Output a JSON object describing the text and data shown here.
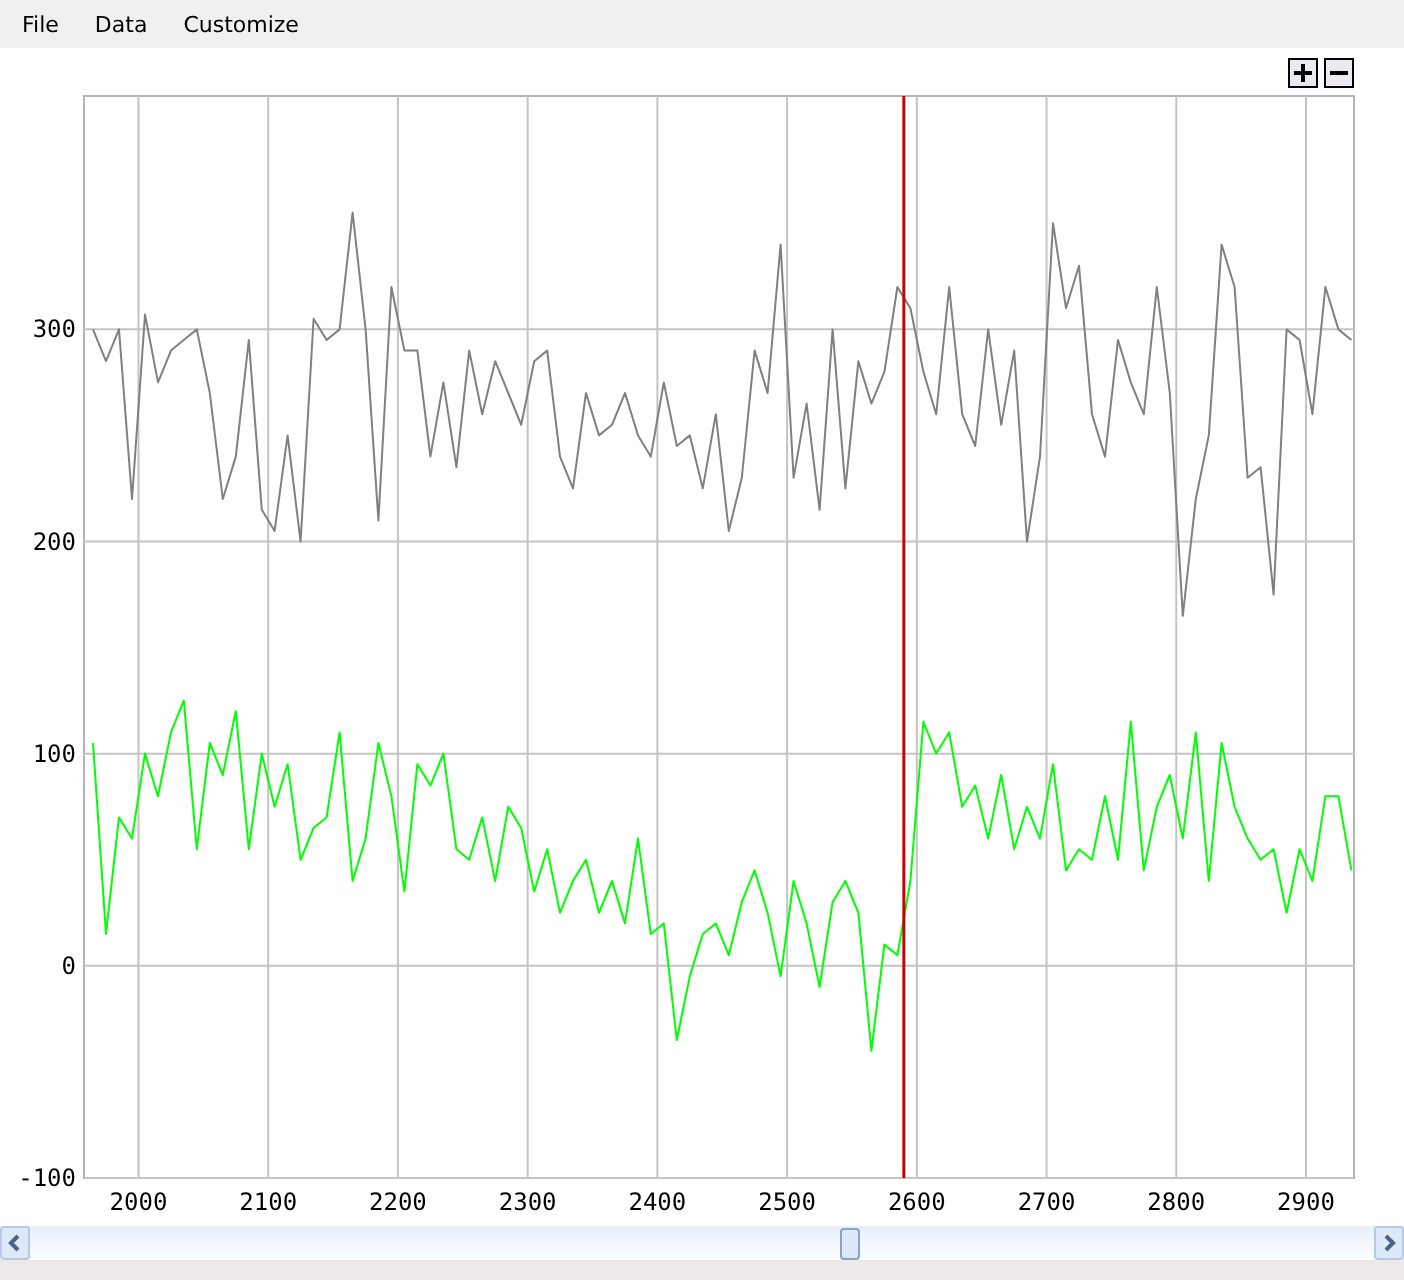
{
  "menu": [
    "File",
    "Data",
    "Customize"
  ],
  "zoom_buttons": [
    {
      "kind": "in"
    },
    {
      "kind": "out"
    }
  ],
  "chart": {
    "chart_data": {
      "type": "line",
      "grid": true,
      "xlim": [
        1958,
        2937
      ],
      "ylim": [
        -100,
        410
      ],
      "xticks": [
        2000,
        2100,
        2200,
        2300,
        2400,
        2500,
        2600,
        2700,
        2800,
        2900
      ],
      "yticks": [
        -100,
        0,
        100,
        200,
        300
      ],
      "x": [
        1965,
        1975,
        1985,
        1995,
        2005,
        2015,
        2025,
        2035,
        2045,
        2055,
        2065,
        2075,
        2085,
        2095,
        2105,
        2115,
        2125,
        2135,
        2145,
        2155,
        2165,
        2175,
        2185,
        2195,
        2205,
        2215,
        2225,
        2235,
        2245,
        2255,
        2265,
        2275,
        2285,
        2295,
        2305,
        2315,
        2325,
        2335,
        2345,
        2355,
        2365,
        2375,
        2385,
        2395,
        2405,
        2415,
        2425,
        2435,
        2445,
        2455,
        2465,
        2475,
        2485,
        2495,
        2505,
        2515,
        2525,
        2535,
        2545,
        2555,
        2565,
        2575,
        2585,
        2595,
        2605,
        2615,
        2625,
        2635,
        2645,
        2655,
        2665,
        2675,
        2685,
        2695,
        2705,
        2715,
        2725,
        2735,
        2745,
        2755,
        2765,
        2775,
        2785,
        2795,
        2805,
        2815,
        2825,
        2835,
        2845,
        2855,
        2865,
        2875,
        2885,
        2895,
        2905,
        2915,
        2925,
        2935
      ],
      "series": [
        {
          "color": "#808080",
          "values": [
            300,
            285,
            300,
            220,
            307,
            275,
            290,
            295,
            300,
            270,
            220,
            240,
            295,
            215,
            205,
            250,
            200,
            305,
            295,
            300,
            355,
            300,
            210,
            320,
            290,
            290,
            240,
            275,
            235,
            290,
            260,
            285,
            270,
            255,
            285,
            290,
            240,
            225,
            270,
            250,
            255,
            270,
            250,
            240,
            275,
            245,
            250,
            225,
            260,
            205,
            230,
            290,
            270,
            340,
            230,
            265,
            215,
            300,
            225,
            285,
            265,
            280,
            320,
            310,
            280,
            260,
            320,
            260,
            245,
            300,
            255,
            290,
            200,
            240,
            350,
            310,
            330,
            260,
            240,
            295,
            275,
            260,
            320,
            270,
            165,
            220,
            250,
            340,
            320,
            230,
            235,
            175,
            300,
            295,
            260,
            320,
            300,
            295
          ]
        },
        {
          "color": "#00ff00",
          "values": [
            105,
            15,
            70,
            60,
            100,
            80,
            110,
            125,
            55,
            105,
            90,
            120,
            55,
            100,
            75,
            95,
            50,
            65,
            70,
            110,
            40,
            60,
            105,
            80,
            35,
            95,
            85,
            100,
            55,
            50,
            70,
            40,
            75,
            65,
            35,
            55,
            25,
            40,
            50,
            25,
            40,
            20,
            60,
            15,
            20,
            -35,
            -5,
            15,
            20,
            5,
            30,
            45,
            25,
            -5,
            40,
            20,
            -10,
            30,
            40,
            25,
            -40,
            10,
            5,
            40,
            115,
            100,
            110,
            75,
            85,
            60,
            90,
            55,
            75,
            60,
            95,
            45,
            55,
            50,
            80,
            50,
            115,
            45,
            75,
            90,
            60,
            110,
            40,
            105,
            75,
            60,
            50,
            55,
            25,
            55,
            40,
            80,
            80,
            45
          ]
        }
      ],
      "ref_lines": [
        {
          "axis": "x",
          "value": 2590
        }
      ]
    }
  }
}
